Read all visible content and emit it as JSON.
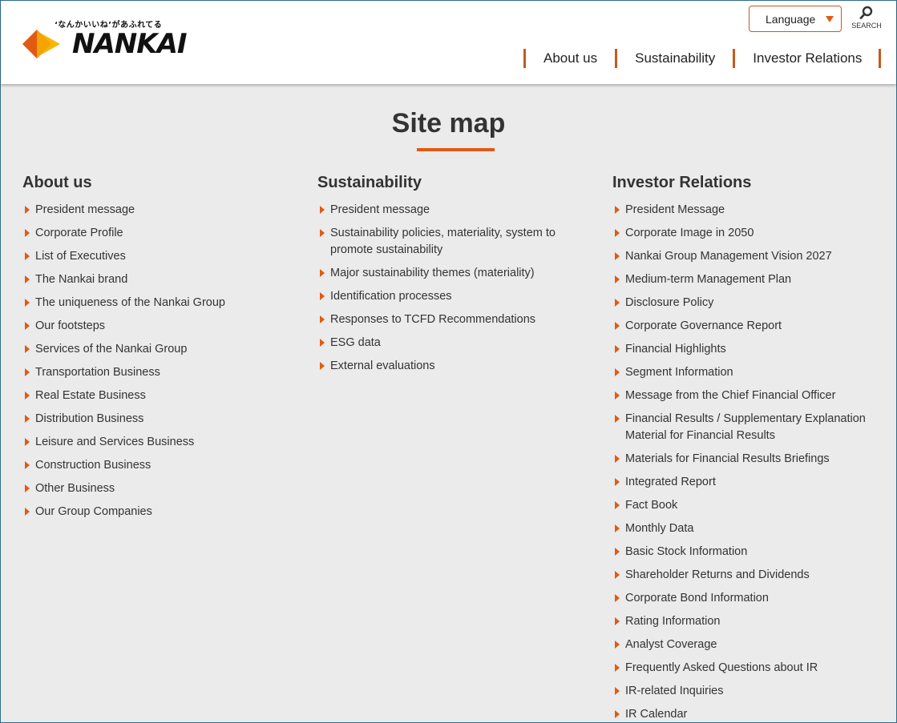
{
  "header": {
    "logo_tagline": "‘なんかいいね’があふれてる",
    "logo_word": "NANKAI",
    "language_label": "Language",
    "search_label": "SEARCH",
    "nav": [
      "About us",
      "Sustainability",
      "Investor Relations"
    ]
  },
  "page_title": "Site map",
  "colors": {
    "accent": "#e05a13",
    "accent_border": "#c65a1e",
    "background": "#ebebeb"
  },
  "columns": {
    "about": {
      "heading": "About us",
      "items": [
        "President message",
        "Corporate Profile",
        "List of Executives",
        "The Nankai brand",
        "The uniqueness of the Nankai Group",
        "Our footsteps",
        "Services of the Nankai Group",
        "Transportation Business",
        "Real Estate Business",
        "Distribution Business",
        "Leisure and Services Business",
        "Construction Business",
        "Other Business",
        "Our Group Companies"
      ]
    },
    "sustainability": {
      "heading": "Sustainability",
      "items": [
        "President message",
        "Sustainability policies, materiality, system to promote sustainability",
        "Major sustainability themes (materiality)",
        "Identification processes",
        "Responses to TCFD Recommendations",
        "ESG data",
        "External evaluations"
      ]
    },
    "ir": {
      "heading": "Investor Relations",
      "items": [
        "President Message",
        "Corporate Image in 2050",
        "Nankai Group Management Vision 2027",
        "Medium-term Management Plan",
        "Disclosure Policy",
        "Corporate Governance Report",
        "Financial Highlights",
        "Segment Information",
        "Message from the Chief Financial Officer",
        "Financial Results / Supplementary Explanation Material for Financial Results",
        "Materials for Financial Results Briefings",
        "Integrated Report",
        "Fact Book",
        "Monthly Data",
        "Basic Stock Information",
        "Shareholder Returns and Dividends",
        "Corporate Bond Information",
        "Rating Information",
        "Analyst Coverage",
        "Frequently Asked Questions about IR",
        "IR-related Inquiries",
        "IR Calendar"
      ]
    }
  }
}
